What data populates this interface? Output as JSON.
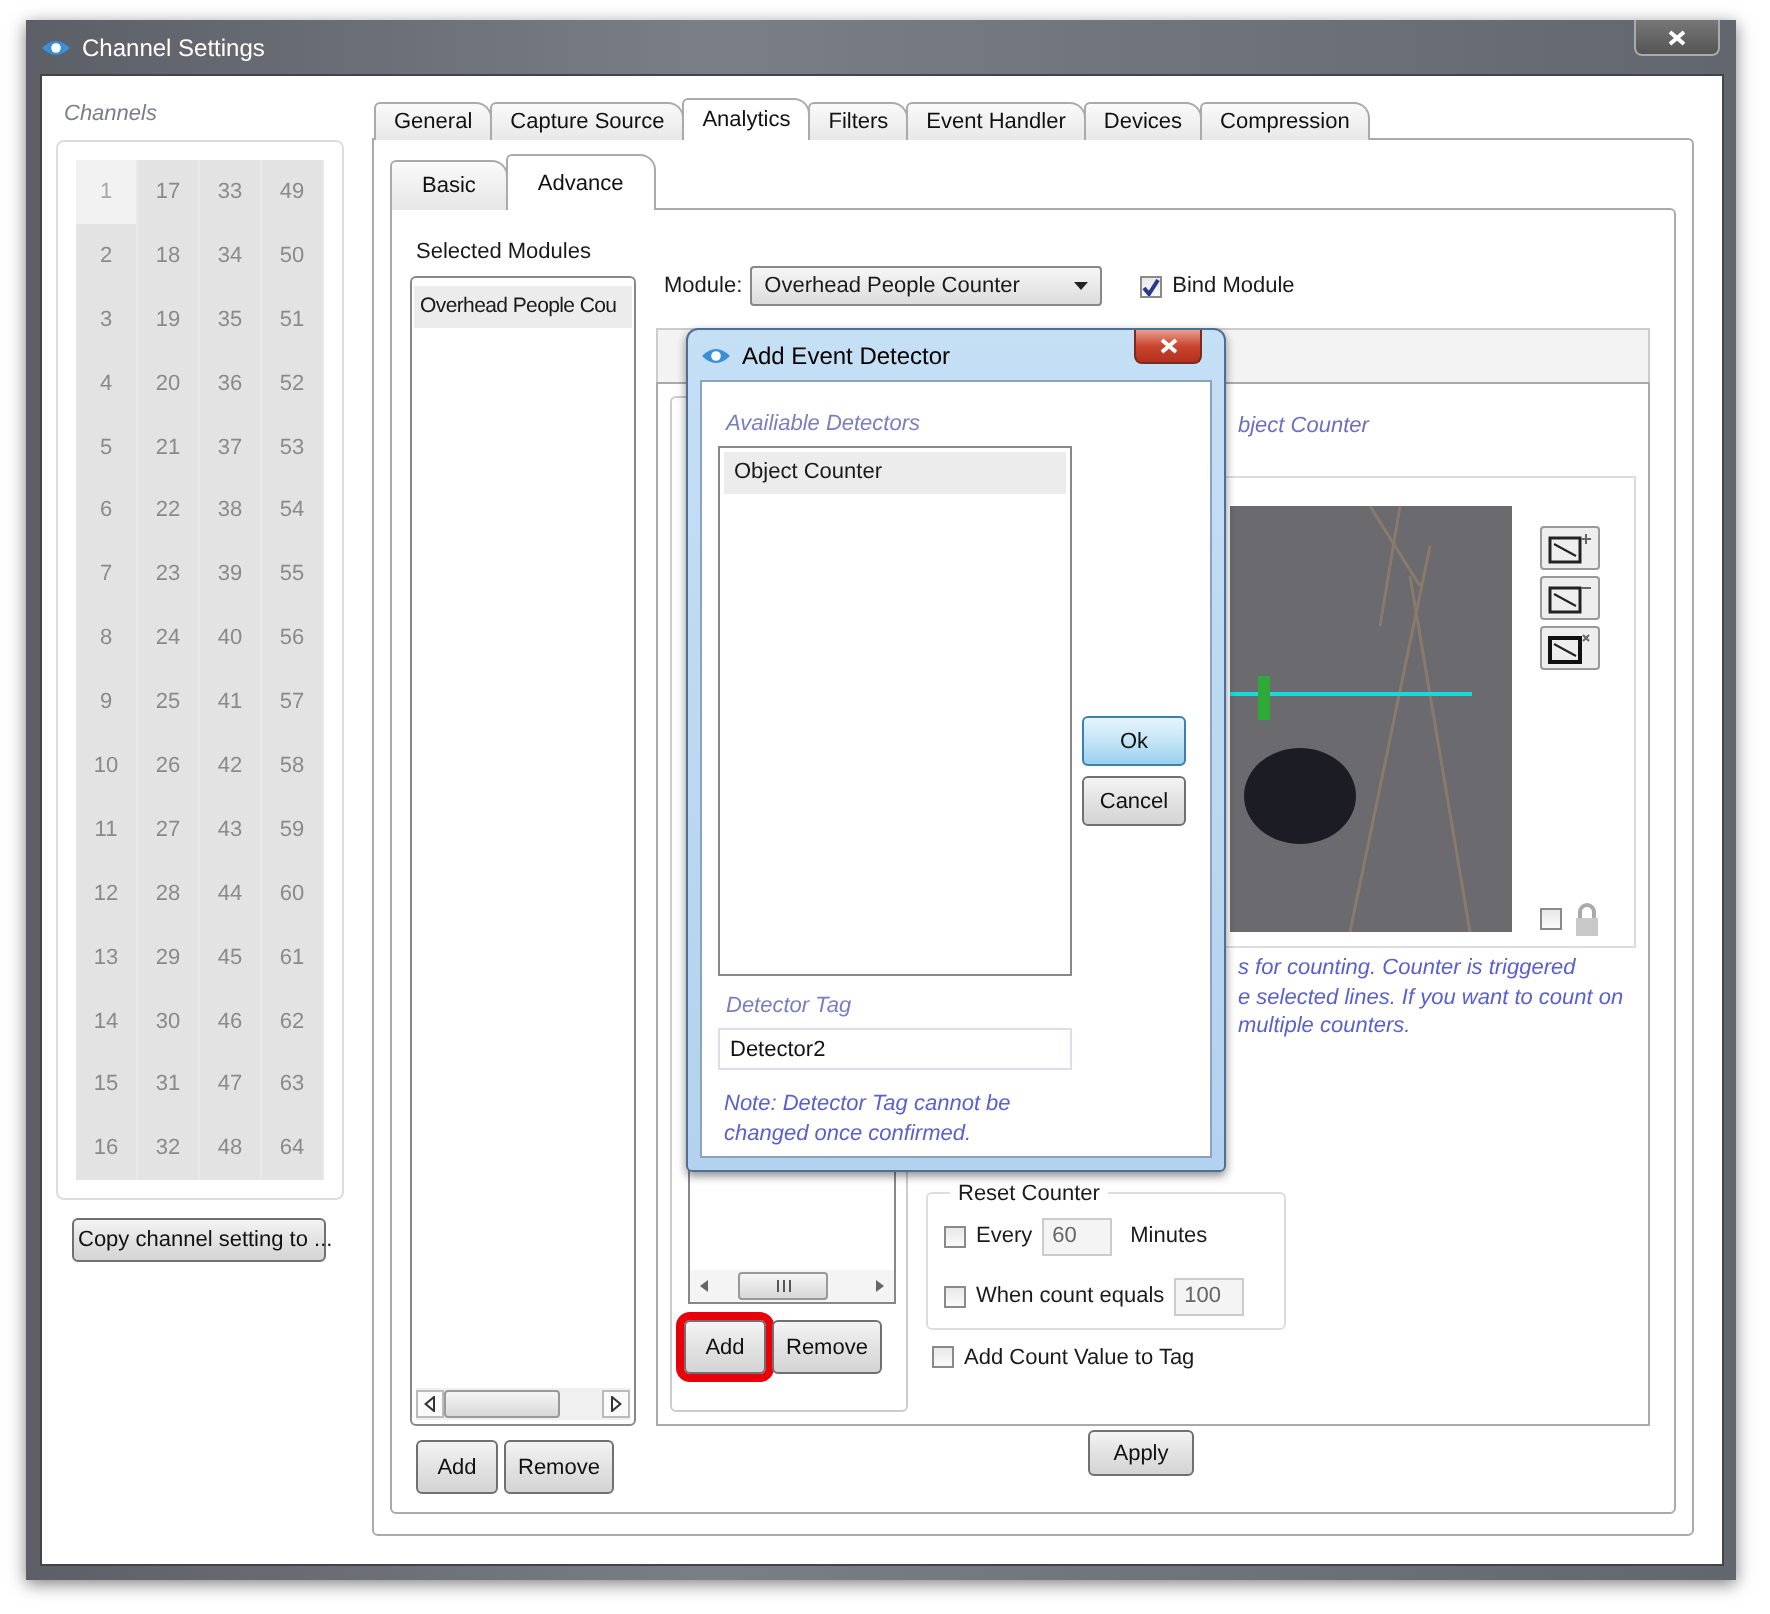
{
  "window": {
    "title": "Channel Settings"
  },
  "channels": {
    "label": "Channels",
    "items": [
      {
        "number": "1",
        "selected": true
      },
      {
        "number": "17",
        "selected": false
      },
      {
        "number": "33",
        "selected": false
      },
      {
        "number": "49",
        "selected": false
      },
      {
        "number": "2",
        "selected": false
      },
      {
        "number": "18",
        "selected": false
      },
      {
        "number": "34",
        "selected": false
      },
      {
        "number": "50",
        "selected": false
      },
      {
        "number": "3",
        "selected": false
      },
      {
        "number": "19",
        "selected": false
      },
      {
        "number": "35",
        "selected": false
      },
      {
        "number": "51",
        "selected": false
      },
      {
        "number": "4",
        "selected": false
      },
      {
        "number": "20",
        "selected": false
      },
      {
        "number": "36",
        "selected": false
      },
      {
        "number": "52",
        "selected": false
      },
      {
        "number": "5",
        "selected": false
      },
      {
        "number": "21",
        "selected": false
      },
      {
        "number": "37",
        "selected": false
      },
      {
        "number": "53",
        "selected": false
      },
      {
        "number": "6",
        "selected": false
      },
      {
        "number": "22",
        "selected": false
      },
      {
        "number": "38",
        "selected": false
      },
      {
        "number": "54",
        "selected": false
      },
      {
        "number": "7",
        "selected": false
      },
      {
        "number": "23",
        "selected": false
      },
      {
        "number": "39",
        "selected": false
      },
      {
        "number": "55",
        "selected": false
      },
      {
        "number": "8",
        "selected": false
      },
      {
        "number": "24",
        "selected": false
      },
      {
        "number": "40",
        "selected": false
      },
      {
        "number": "56",
        "selected": false
      },
      {
        "number": "9",
        "selected": false
      },
      {
        "number": "25",
        "selected": false
      },
      {
        "number": "41",
        "selected": false
      },
      {
        "number": "57",
        "selected": false
      },
      {
        "number": "10",
        "selected": false
      },
      {
        "number": "26",
        "selected": false
      },
      {
        "number": "42",
        "selected": false
      },
      {
        "number": "58",
        "selected": false
      },
      {
        "number": "11",
        "selected": false
      },
      {
        "number": "27",
        "selected": false
      },
      {
        "number": "43",
        "selected": false
      },
      {
        "number": "59",
        "selected": false
      },
      {
        "number": "12",
        "selected": false
      },
      {
        "number": "28",
        "selected": false
      },
      {
        "number": "44",
        "selected": false
      },
      {
        "number": "60",
        "selected": false
      },
      {
        "number": "13",
        "selected": false
      },
      {
        "number": "29",
        "selected": false
      },
      {
        "number": "45",
        "selected": false
      },
      {
        "number": "61",
        "selected": false
      },
      {
        "number": "14",
        "selected": false
      },
      {
        "number": "30",
        "selected": false
      },
      {
        "number": "46",
        "selected": false
      },
      {
        "number": "62",
        "selected": false
      },
      {
        "number": "15",
        "selected": false
      },
      {
        "number": "31",
        "selected": false
      },
      {
        "number": "47",
        "selected": false
      },
      {
        "number": "63",
        "selected": false
      },
      {
        "number": "16",
        "selected": false
      },
      {
        "number": "32",
        "selected": false
      },
      {
        "number": "48",
        "selected": false
      },
      {
        "number": "64",
        "selected": false
      }
    ]
  },
  "copy_button": "Copy channel setting to ...",
  "tabs": [
    {
      "label": "General",
      "selected": false
    },
    {
      "label": "Capture Source",
      "selected": false
    },
    {
      "label": "Analytics",
      "selected": true
    },
    {
      "label": "Filters",
      "selected": false
    },
    {
      "label": "Event Handler",
      "selected": false
    },
    {
      "label": "Devices",
      "selected": false
    },
    {
      "label": "Compression",
      "selected": false
    }
  ],
  "subtabs": [
    {
      "label": "Basic",
      "selected": false
    },
    {
      "label": "Advance",
      "selected": true
    }
  ],
  "selected_modules": {
    "label": "Selected Modules",
    "items": [
      {
        "label": "Overhead People Cou",
        "selected": true
      }
    ],
    "buttons": [
      "Add",
      "Remove"
    ]
  },
  "module": {
    "label": "Module:",
    "value": "Overhead People Counter"
  },
  "bind_module": {
    "label": "Bind Module",
    "checked": true
  },
  "detectors": {
    "add_button": {
      "label": "Add",
      "highlighted": true
    },
    "remove_button": "Remove"
  },
  "detector_title": "bject Counter",
  "lock_checkbox": {
    "checked": false
  },
  "note_lines": [
    "s for counting. Counter is triggered",
    "e selected lines. If you want to count on",
    "multiple counters."
  ],
  "reset_counter": {
    "title": "Reset Counter",
    "every": {
      "label": "Every",
      "checked": false,
      "value": "60",
      "unit": "Minutes"
    },
    "count_equals": {
      "label": "When count equals",
      "checked": false,
      "value": "100"
    }
  },
  "add_count_value": {
    "label": "Add Count Value to Tag",
    "checked": false
  },
  "apply_button": "Apply",
  "dialog": {
    "title": "Add Event Detector",
    "list_label": "Availiable Detectors",
    "items": [
      {
        "label": "Object Counter",
        "selected": true
      }
    ],
    "ok_button": "Ok",
    "cancel_button": "Cancel",
    "tag_label": "Detector Tag",
    "tag_value": "Detector2",
    "note": "Note: Detector Tag cannot be changed once confirmed."
  }
}
